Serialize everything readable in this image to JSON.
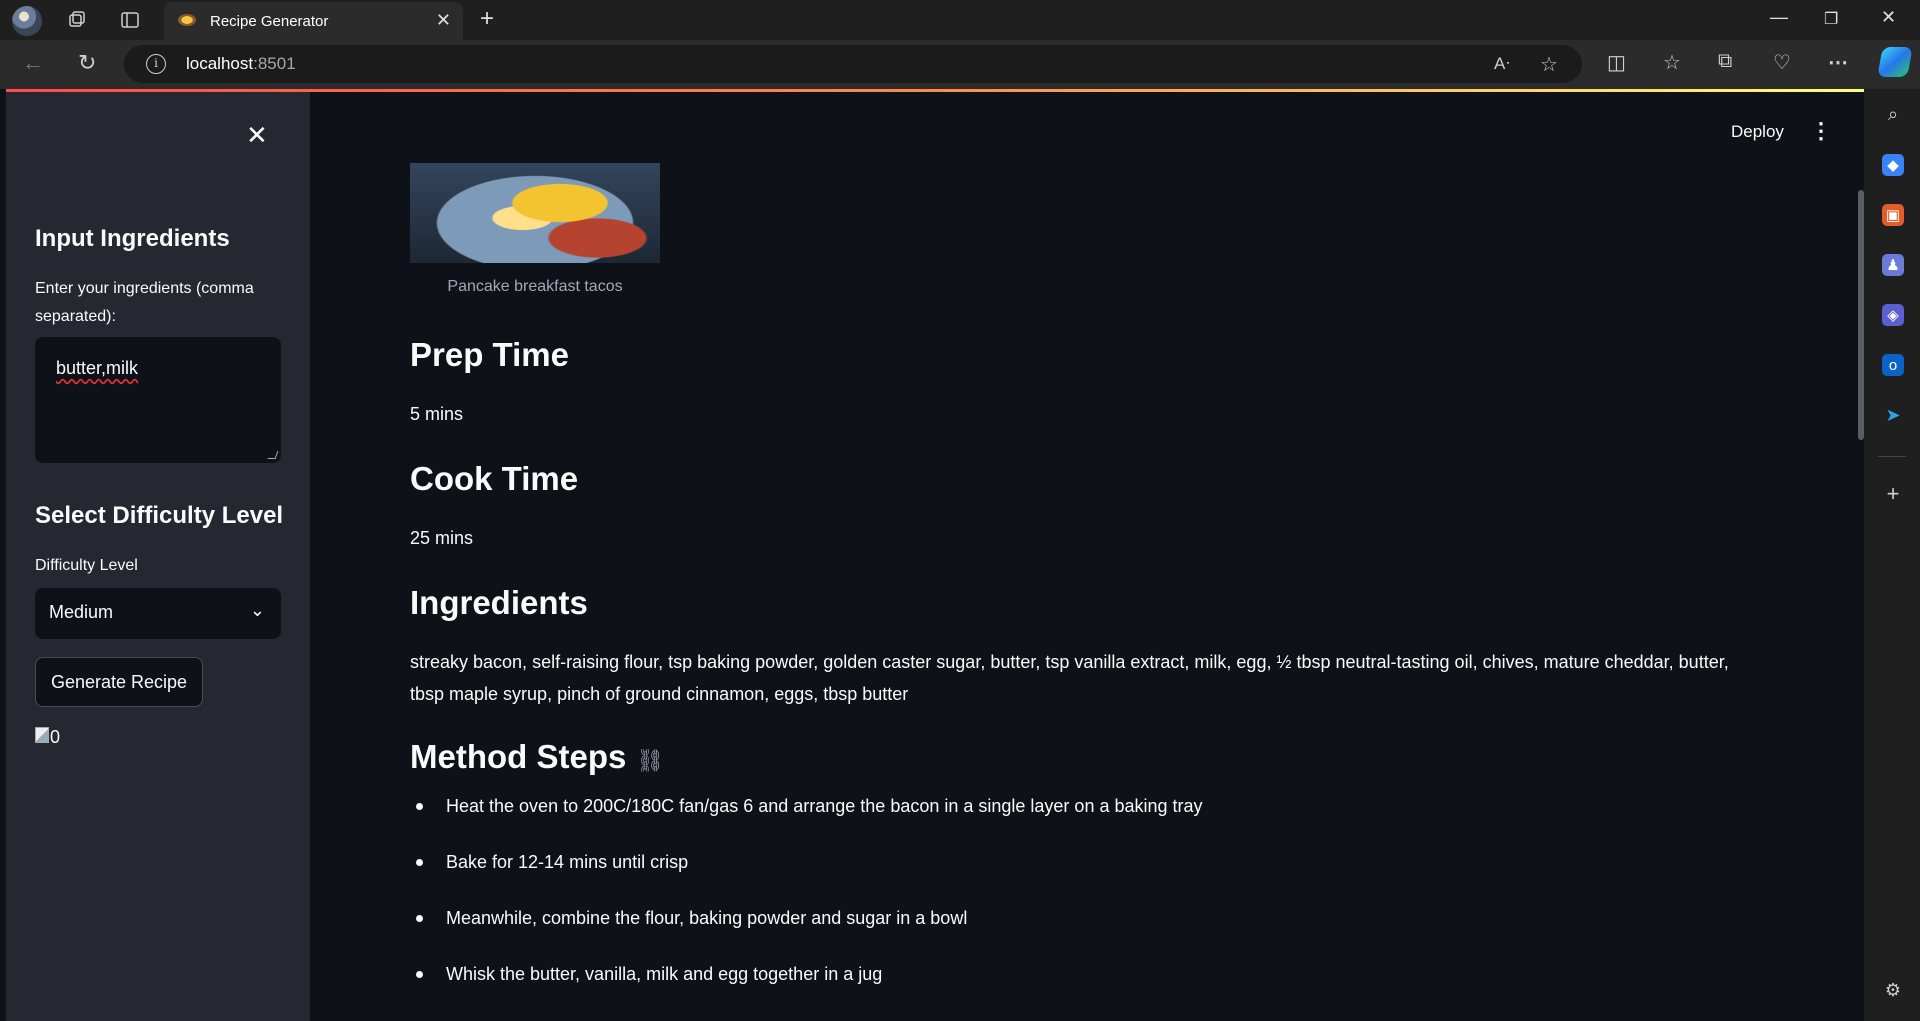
{
  "browser": {
    "tab_title": "Recipe Generator",
    "url_host": "localhost",
    "url_port": ":8501"
  },
  "app": {
    "deploy_label": "Deploy"
  },
  "sidebar": {
    "ingredients_heading": "Input Ingredients",
    "ingredients_label": "Enter your ingredients (comma separated):",
    "ingredients_value": "butter,milk",
    "difficulty_heading": "Select Difficulty Level",
    "difficulty_label": "Difficulty Level",
    "difficulty_value": "Medium",
    "generate_button": "Generate Recipe",
    "broken_image_alt": "0"
  },
  "recipe": {
    "image_caption": "Pancake breakfast tacos",
    "prep_heading": "Prep Time",
    "prep_value": "5 mins",
    "cook_heading": "Cook Time",
    "cook_value": "25 mins",
    "ingredients_heading": "Ingredients",
    "ingredients_text": "streaky bacon, self-raising flour, tsp baking powder, golden caster sugar, butter, tsp vanilla extract, milk, egg, ½ tbsp neutral-tasting oil, chives, mature cheddar, butter, tbsp maple syrup, pinch of ground cinnamon, eggs, tbsp butter",
    "method_heading": "Method Steps",
    "steps": [
      "Heat the oven to 200C/180C fan/gas 6 and arrange the bacon in a single layer on a baking tray",
      "Bake for 12-14 mins until crisp",
      "Meanwhile, combine the flour, baking powder and sugar in a bowl",
      "Whisk the butter, vanilla, milk and egg together in a jug"
    ]
  },
  "colors": {
    "app_bg": "#0e1117",
    "sidebar_bg": "#262730",
    "accent_gradient_start": "#ff4b4b",
    "accent_gradient_end": "#fffd80"
  }
}
